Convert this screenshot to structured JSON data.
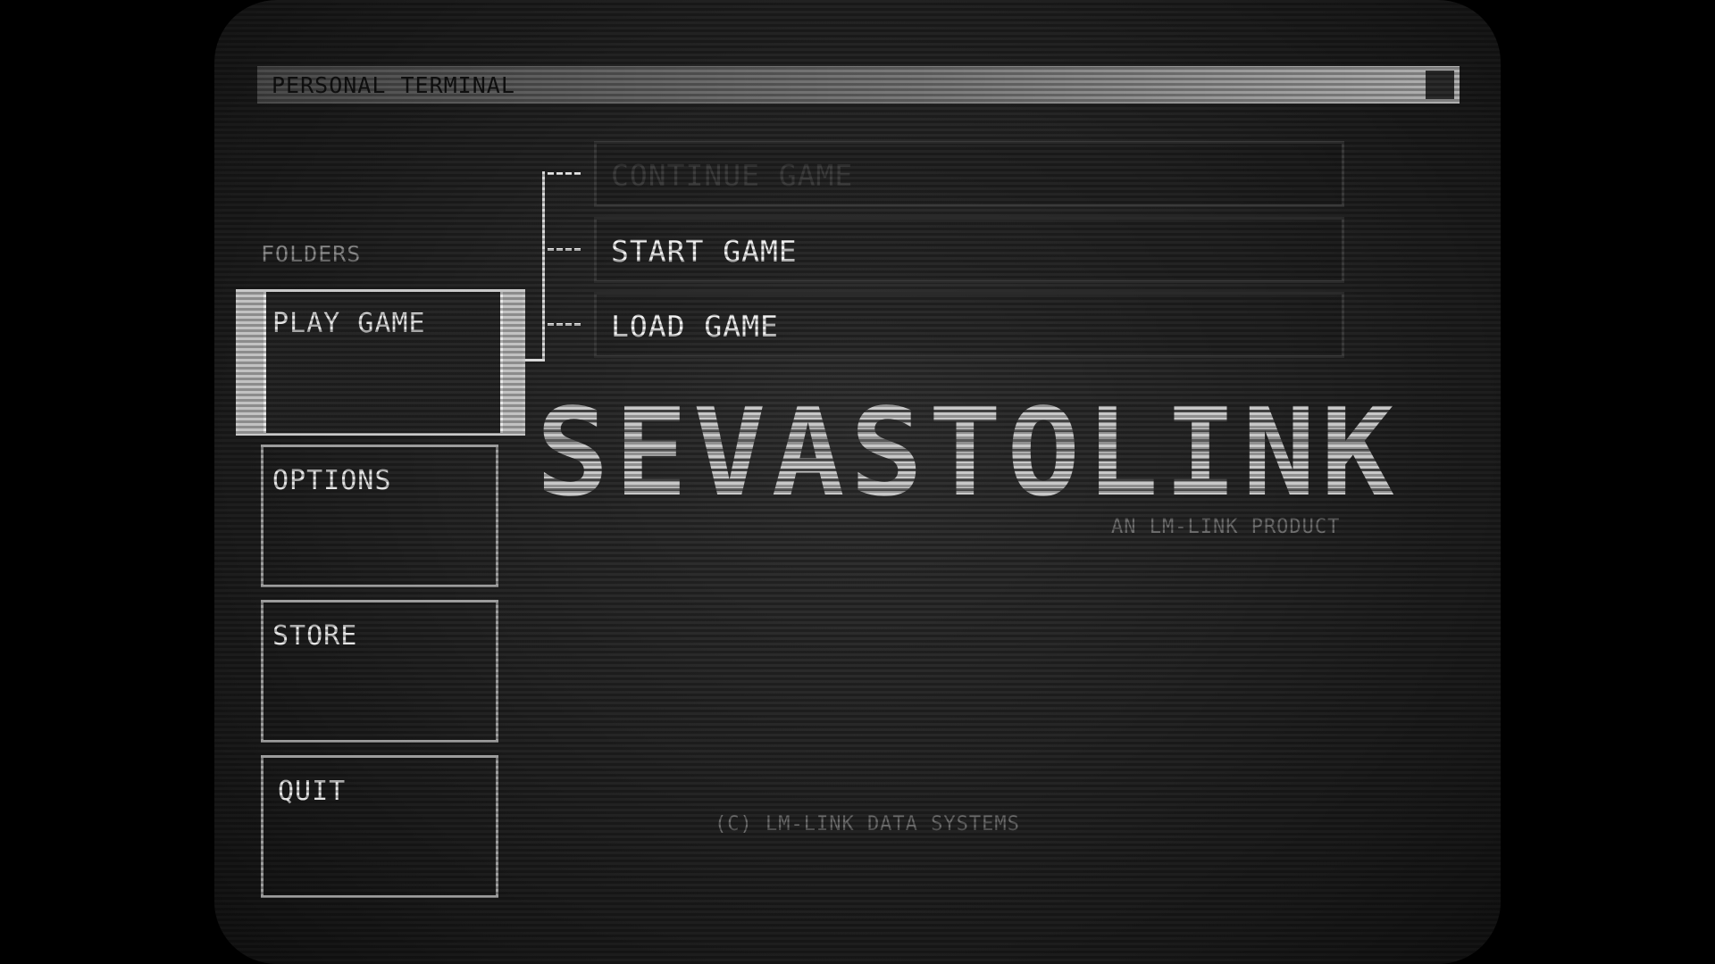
{
  "window": {
    "title": "PERSONAL TERMINAL",
    "close_icon": "close-square-icon"
  },
  "sidebar": {
    "heading": "FOLDERS",
    "items": [
      {
        "label": "PLAY GAME",
        "selected": true
      },
      {
        "label": "OPTIONS",
        "selected": false
      },
      {
        "label": "STORE",
        "selected": false
      },
      {
        "label": "QUIT",
        "selected": false
      }
    ]
  },
  "submenu": {
    "items": [
      {
        "label": "CONTINUE GAME",
        "enabled": false
      },
      {
        "label": "START GAME",
        "enabled": true
      },
      {
        "label": "LOAD GAME",
        "enabled": true
      }
    ]
  },
  "brand": {
    "logo": "SEVASTOLINK",
    "tagline": "AN LM-LINK PRODUCT",
    "copyright": "(C) LM-LINK DATA SYSTEMS"
  },
  "colors": {
    "background": "#000000",
    "screen": "#262626",
    "text": "#f0f0f0",
    "muted": "#6e6e6e",
    "selected": "#c2c2c2"
  }
}
